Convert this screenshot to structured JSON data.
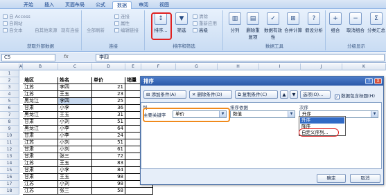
{
  "ribbon": {
    "tabs": [
      "开始",
      "插入",
      "页面布局",
      "公式",
      "数据",
      "审阅",
      "视图"
    ],
    "active_tab": "数据",
    "get_external": {
      "items": [
        "自 Access",
        "自网站",
        "自文本",
        "自其他来源",
        "现有连接"
      ],
      "label": "获取外部数据"
    },
    "connections": {
      "items": [
        "全部刷新",
        "连接",
        "属性",
        "编辑链接"
      ],
      "label": "连接"
    },
    "sort_filter": {
      "items": [
        "排序...",
        "筛选",
        "清除",
        "重新应用",
        "高级"
      ],
      "label": "排序和筛选"
    },
    "data_tools": {
      "items": [
        "分列",
        "删除重复项",
        "数据有效性",
        "合并计算",
        "假设分析"
      ],
      "label": "数据工具"
    },
    "outline": {
      "items": [
        "组合",
        "取消组合",
        "分类汇总"
      ],
      "label": "分级显示"
    }
  },
  "formula_bar": {
    "cell_ref": "C5",
    "fx": "fx",
    "value": "李四"
  },
  "sheet": {
    "columns": [
      "A",
      "B",
      "C",
      "D",
      "E",
      "F",
      "G",
      "H",
      "I",
      "J",
      "K"
    ],
    "rows": [
      "1",
      "2",
      "3",
      "4",
      "5",
      "6",
      "7",
      "8",
      "9",
      "10",
      "11",
      "12",
      "13",
      "14",
      "15",
      "16",
      "17",
      "18"
    ],
    "headers": [
      "地区",
      "姓名",
      "单价",
      "销量"
    ],
    "data": [
      [
        "江苏",
        "李四",
        "21"
      ],
      [
        "江苏",
        "王五",
        "23"
      ],
      [
        "黑龙江",
        "李四",
        "25"
      ],
      [
        "甘肃",
        "小李",
        "36"
      ],
      [
        "黑龙江",
        "王五",
        "31"
      ],
      [
        "甘肃",
        "小刘",
        "51"
      ],
      [
        "黑龙江",
        "小李",
        "64"
      ],
      [
        "甘肃",
        "小李",
        "24"
      ],
      [
        "江苏",
        "小刘",
        "51"
      ],
      [
        "甘肃",
        "小刘",
        "61"
      ],
      [
        "甘肃",
        "张三",
        "72"
      ],
      [
        "江苏",
        "王五",
        "83"
      ],
      [
        "甘肃",
        "小李",
        "84"
      ],
      [
        "甘肃",
        "王五",
        "98"
      ],
      [
        "江苏",
        "小刘",
        "98"
      ],
      [
        "江苏",
        "张三",
        "58"
      ]
    ]
  },
  "dialog": {
    "title": "排序",
    "help": "?",
    "close": "X",
    "add_level": "添加条件(A)",
    "delete_level": "删除条件(D)",
    "copy_level": "复制条件(C)",
    "options": "选项(O)...",
    "header_checkbox": "数据包含标题(H)",
    "header_checked": true,
    "col_header_column": "列",
    "col_header_sorton": "排序依据",
    "col_header_order": "次序",
    "row_label": "主要关键字",
    "key_value": "单价",
    "sorton_value": "数值",
    "order_value": "升序",
    "order_options": [
      "升序",
      "降序",
      "自定义序列..."
    ],
    "highlighted_option": "升序",
    "ok": "确定",
    "cancel": "取消"
  }
}
